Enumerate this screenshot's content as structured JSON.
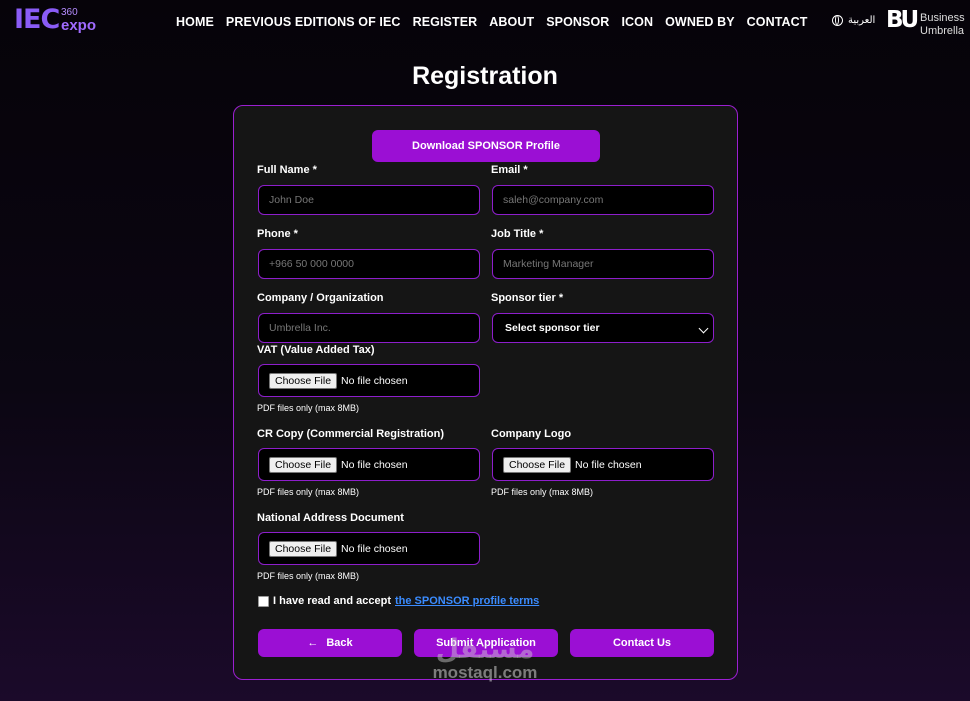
{
  "header": {
    "logo": {
      "brand": "IEC",
      "superscript": "360",
      "sub": "expo"
    },
    "nav": [
      "HOME",
      "PREVIOUS EDITIONS OF IEC",
      "REGISTER",
      "ABOUT",
      "SPONSOR",
      "ICON",
      "OWNED BY",
      "CONTACT"
    ],
    "language_label": "العربية",
    "partner_logo": {
      "mark": "BU",
      "line1": "Business",
      "line2": "Umbrella"
    }
  },
  "page_title": "Registration",
  "form": {
    "download_button": "Download SPONSOR Profile",
    "full_name": {
      "label": "Full Name *",
      "placeholder": "John Doe"
    },
    "email": {
      "label": "Email *",
      "placeholder": "saleh@company.com"
    },
    "phone": {
      "label": "Phone *",
      "placeholder": "+966 50 000 0000"
    },
    "job_title": {
      "label": "Job Title *",
      "placeholder": "Marketing Manager"
    },
    "company": {
      "label": "Company / Organization",
      "placeholder": "Umbrella Inc."
    },
    "sponsor_tier": {
      "label": "Sponsor tier *",
      "selected": "Select sponsor tier"
    },
    "vat": {
      "label": "VAT (Value Added Tax)",
      "button": "Choose File",
      "status": "No file chosen",
      "hint": "PDF files only (max 8MB)"
    },
    "cr_copy": {
      "label": "CR Copy (Commercial Registration)",
      "button": "Choose File",
      "status": "No file chosen",
      "hint": "PDF files only (max 8MB)"
    },
    "company_logo": {
      "label": "Company Logo",
      "button": "Choose File",
      "status": "No file chosen",
      "hint": "PDF files only (max 8MB)"
    },
    "national_address": {
      "label": "National Address Document",
      "button": "Choose File",
      "status": "No file chosen",
      "hint": "PDF files only (max 8MB)"
    },
    "terms": {
      "text": "I have read and accept",
      "link": "the SPONSOR profile terms",
      "checked": false
    },
    "back_button": "Back",
    "submit_button": "Submit Application",
    "contact_button": "Contact Us"
  },
  "watermark": {
    "arabic": "مستقل",
    "latin": "mostaql.com"
  },
  "colors": {
    "accent": "#9b0fd4",
    "border": "#8d1ecb",
    "link": "#3b8cff",
    "card": "#151515"
  }
}
